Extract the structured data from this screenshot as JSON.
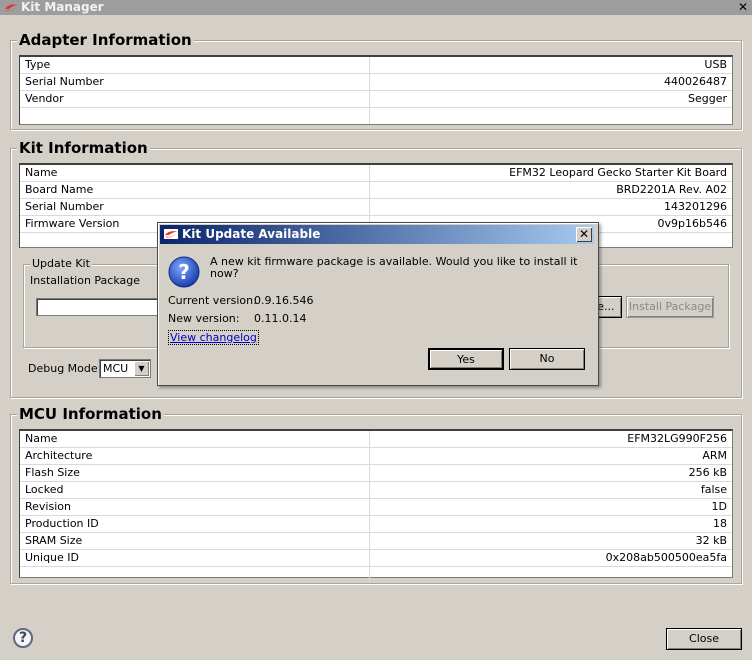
{
  "window": {
    "title": "Kit Manager",
    "close_glyph": "✕"
  },
  "adapter": {
    "title": "Adapter Information",
    "rows": [
      {
        "label": "Type",
        "value": "USB"
      },
      {
        "label": "Serial Number",
        "value": "440026487"
      },
      {
        "label": "Vendor",
        "value": "Segger"
      }
    ]
  },
  "kit": {
    "title": "Kit Information",
    "rows": [
      {
        "label": "Name",
        "value": "EFM32 Leopard Gecko Starter Kit Board"
      },
      {
        "label": "Board Name",
        "value": "BRD2201A Rev. A02"
      },
      {
        "label": "Serial Number",
        "value": "143201296"
      },
      {
        "label": "Firmware Version",
        "value": "0v9p16b546"
      }
    ]
  },
  "update_kit": {
    "title": "Update Kit",
    "installation_package_label": "Installation Package",
    "browse_label": "se...",
    "install_label": "Install Package"
  },
  "debug_mode": {
    "label": "Debug Mode:",
    "value": "MCU"
  },
  "mcu": {
    "title": "MCU Information",
    "rows": [
      {
        "label": "Name",
        "value": "EFM32LG990F256"
      },
      {
        "label": "Architecture",
        "value": "ARM"
      },
      {
        "label": "Flash Size",
        "value": "256 kB"
      },
      {
        "label": "Locked",
        "value": "false"
      },
      {
        "label": "Revision",
        "value": "1D"
      },
      {
        "label": "Production ID",
        "value": "18"
      },
      {
        "label": "SRAM Size",
        "value": "32 kB"
      },
      {
        "label": "Unique ID",
        "value": "0x208ab500500ea5fa"
      }
    ]
  },
  "dialog": {
    "title": "Kit Update Available",
    "message": "A new kit firmware package is available.  Would you like to install it now?",
    "current_label": "Current version:",
    "current_value": "0.9.16.546",
    "new_label": "New version:",
    "new_value": "0.11.0.14",
    "changelog_link": "View changelog",
    "yes_label": "Yes",
    "no_label": "No",
    "icon": "question-icon"
  },
  "footer": {
    "close_label": "Close",
    "help_glyph": "?"
  }
}
